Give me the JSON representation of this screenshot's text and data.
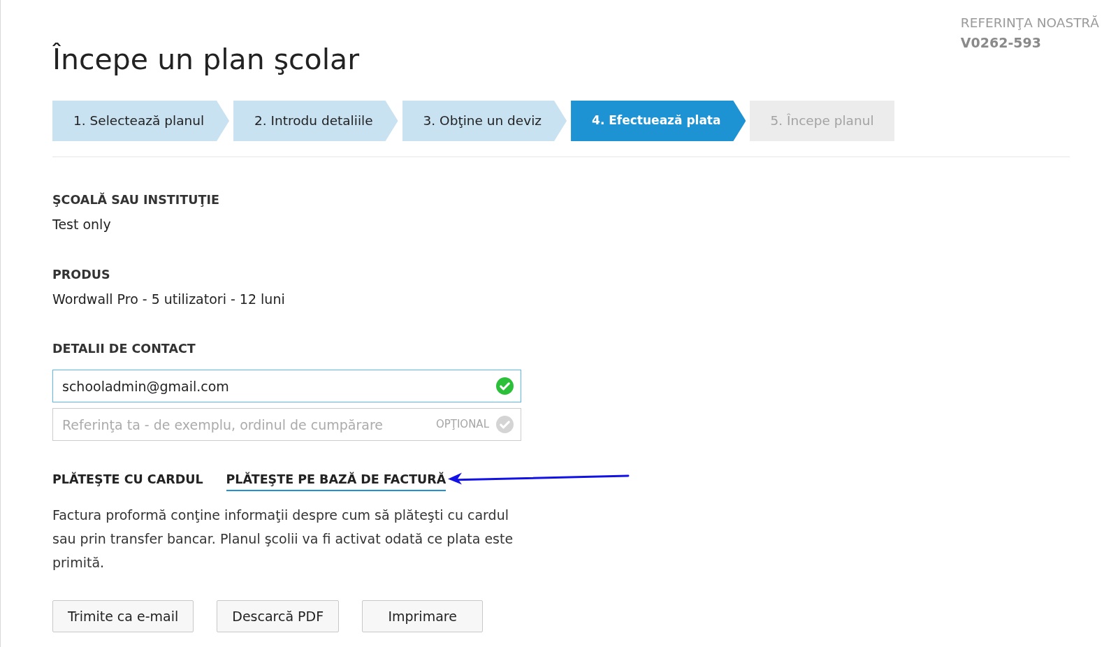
{
  "page": {
    "title": "Începe un plan şcolar"
  },
  "reference": {
    "label": "REFERINŢA NOASTRĂ",
    "value": "V0262-593"
  },
  "steps": [
    {
      "label": "1. Selectează planul",
      "selected": false,
      "completed": true
    },
    {
      "label": "2. Introdu detaliile",
      "selected": false,
      "completed": true
    },
    {
      "label": "3. Obţine un deviz",
      "selected": false,
      "completed": true
    },
    {
      "label": "4. Efectuează plata",
      "selected": true,
      "completed": false
    },
    {
      "label": "5. Începe planul",
      "selected": false,
      "completed": false
    }
  ],
  "details": [
    {
      "label": "ŞCOALĂ SAU INSTITUŢIE",
      "value": "Test only"
    },
    {
      "label": "PRODUS",
      "value": "Wordwall Pro - 5 utilizatori - 12 luni"
    }
  ],
  "contact": {
    "label": "DETALII DE CONTACT",
    "fields": [
      {
        "value": "schooladmin@gmail.com",
        "focused": true,
        "valid": true
      },
      {
        "placeholder": "Referinţa ta - de exemplu, ordinul de cumpărare",
        "hint": "OPŢIONAL",
        "focused": false,
        "valid": false
      }
    ]
  },
  "payment_tabs": [
    {
      "label": "PLĂTEŞTE CU CARDUL",
      "selected": false
    },
    {
      "label": "PLĂTEŞTE PE BAZĂ DE FACTURĂ",
      "selected": true
    }
  ],
  "description": "Factura proformă conţine informaţii despre cum să plăteşti cu cardul sau prin transfer bancar. Planul şcolii va fi activat odată ce plata este primită.",
  "buttons": [
    "Trimite ca e-mail",
    "Descarcă PDF",
    "Imprimare"
  ]
}
